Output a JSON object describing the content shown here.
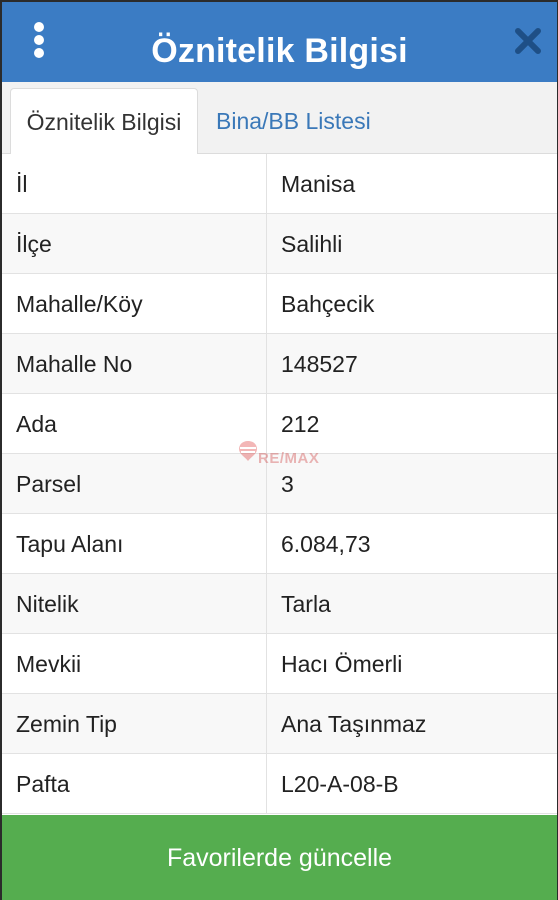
{
  "header": {
    "title": "Öznitelik Bilgisi",
    "menu_icon": "more-vertical-icon",
    "close_icon": "close-icon",
    "color": "#3b7cc4"
  },
  "tabs": [
    {
      "label": "Öznitelik Bilgisi",
      "active": true
    },
    {
      "label": "Bina/BB Listesi",
      "active": false
    }
  ],
  "attributes": [
    {
      "key": "İl",
      "value": "Manisa"
    },
    {
      "key": "İlçe",
      "value": "Salihli"
    },
    {
      "key": "Mahalle/Köy",
      "value": "Bahçecik"
    },
    {
      "key": "Mahalle No",
      "value": "148527"
    },
    {
      "key": "Ada",
      "value": "212"
    },
    {
      "key": "Parsel",
      "value": "3"
    },
    {
      "key": "Tapu Alanı",
      "value": "6.084,73"
    },
    {
      "key": "Nitelik",
      "value": "Tarla"
    },
    {
      "key": "Mevkii",
      "value": "Hacı Ömerli"
    },
    {
      "key": "Zemin Tip",
      "value": "Ana Taşınmaz"
    },
    {
      "key": "Pafta",
      "value": "L20-A-08-B"
    }
  ],
  "watermark": {
    "text": "RE/MAX"
  },
  "footer": {
    "button_label": "Favorilerde güncelle",
    "color": "#55ad4f"
  }
}
